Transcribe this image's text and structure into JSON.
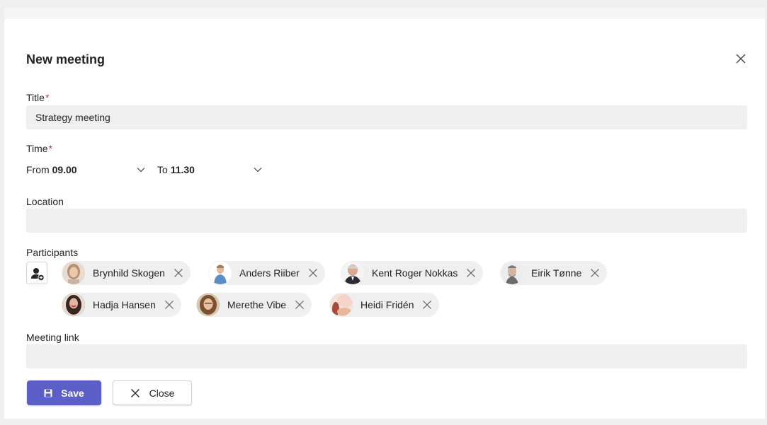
{
  "dialog": {
    "title": "New meeting"
  },
  "form": {
    "title_label": "Title",
    "title_value": "Strategy meeting",
    "required_marker": "*",
    "time_label": "Time",
    "from_label": "From",
    "from_value": "09.00",
    "to_label": "To",
    "to_value": "11.30",
    "location_label": "Location",
    "location_value": "",
    "participants_label": "Participants",
    "meeting_link_label": "Meeting link",
    "meeting_link_value": ""
  },
  "participants": [
    {
      "name": "Brynhild Skogen"
    },
    {
      "name": "Anders Riiber"
    },
    {
      "name": "Kent Roger Nokkas"
    },
    {
      "name": "Eirik Tønne"
    },
    {
      "name": "Hadja Hansen"
    },
    {
      "name": "Merethe Vibe"
    },
    {
      "name": "Heidi Fridén"
    }
  ],
  "buttons": {
    "save": "Save",
    "close": "Close"
  },
  "colors": {
    "accent": "#5b5fc7",
    "required": "#c4314b",
    "field_bg": "#f0efef"
  },
  "icons": {
    "dismiss": "close-icon",
    "add_participant": "add-person-icon",
    "save": "save-icon",
    "dropdown": "chevron-down-icon"
  }
}
